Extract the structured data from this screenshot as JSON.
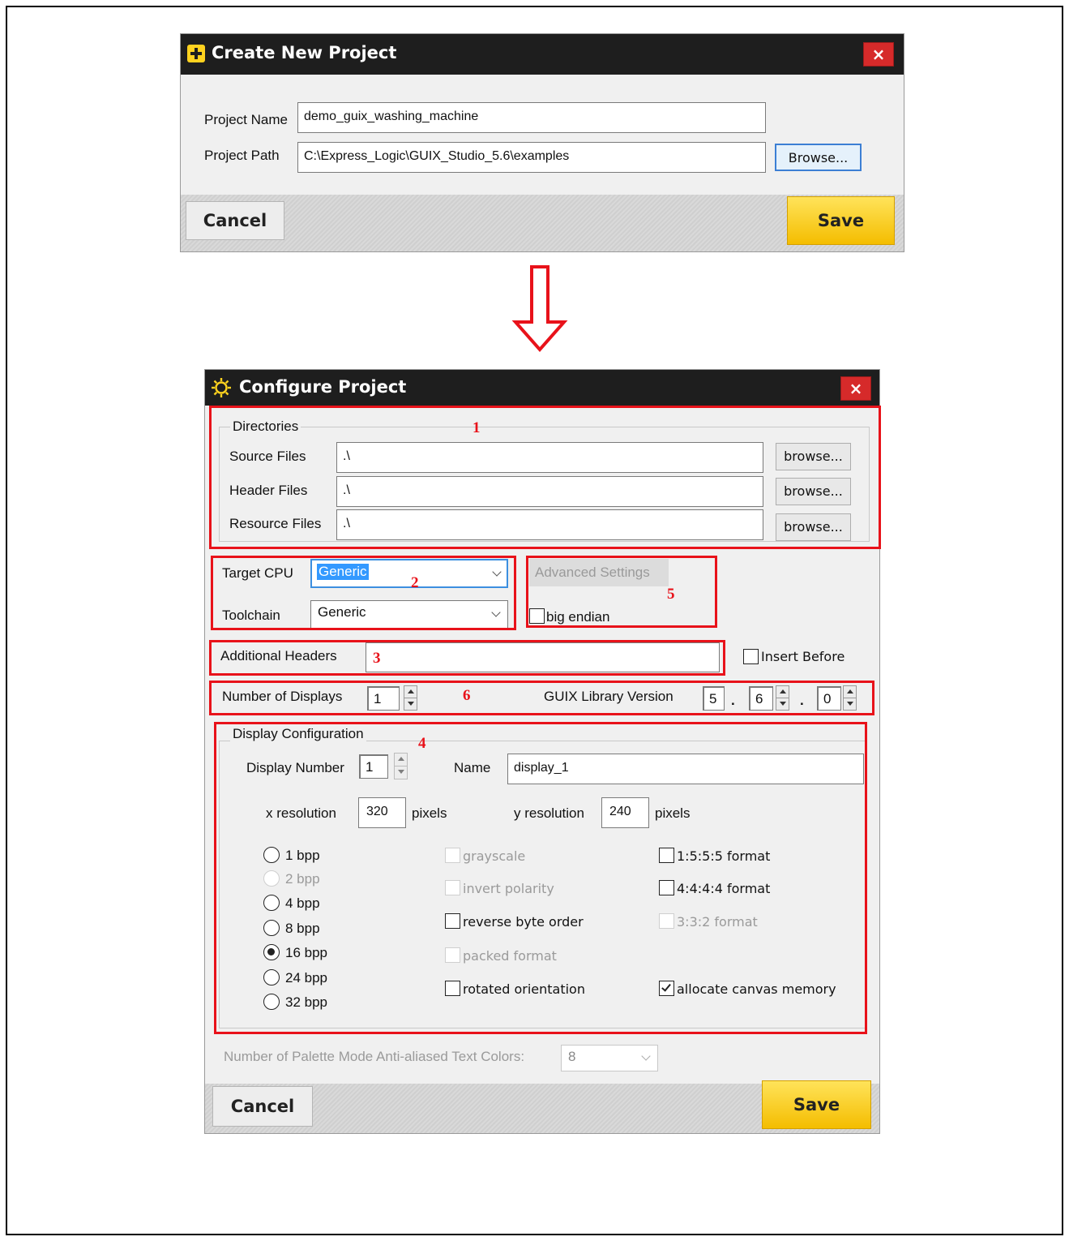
{
  "create_dialog": {
    "title": "Create New Project",
    "close_glyph": "×",
    "project_name_label": "Project Name",
    "project_name_value": "demo_guix_washing_machine",
    "project_path_label": "Project Path",
    "project_path_value": "C:\\Express_Logic\\GUIX_Studio_5.6\\examples",
    "browse_label": "Browse...",
    "cancel_label": "Cancel",
    "save_label": "Save",
    "accent_color": "#ffd21f"
  },
  "arrow": {
    "direction": "down",
    "color": "#e8121a"
  },
  "configure_dialog": {
    "title": "Configure Project",
    "close_glyph": "×",
    "directories": {
      "group_title": "Directories",
      "rows": [
        {
          "label": "Source Files",
          "value": ".\\",
          "button": "browse..."
        },
        {
          "label": "Header Files",
          "value": ".\\",
          "button": "browse..."
        },
        {
          "label": "Resource Files",
          "value": ".\\",
          "button": "browse..."
        }
      ]
    },
    "target_cpu_label": "Target CPU",
    "target_cpu_value": "Generic",
    "toolchain_label": "Toolchain",
    "toolchain_value": "Generic",
    "advanced_settings_label": "Advanced Settings",
    "big_endian_label": "big endian",
    "big_endian_checked": false,
    "additional_headers_label": "Additional Headers",
    "additional_headers_value": "",
    "insert_before_label": "Insert Before",
    "insert_before_checked": false,
    "num_displays_label": "Number of Displays",
    "num_displays_value": "1",
    "guix_version_label": "GUIX Library Version",
    "guix_version_major": "5",
    "guix_version_minor": "6",
    "guix_version_patch": "0",
    "version_sep": ".",
    "display_config": {
      "group_title": "Display Configuration",
      "display_number_label": "Display Number",
      "display_number_value": "1",
      "name_label": "Name",
      "name_value": "display_1",
      "x_res_label": "x resolution",
      "x_res_value": "320",
      "y_res_label": "y resolution",
      "y_res_value": "240",
      "pixels_label": "pixels",
      "bpp_options": [
        {
          "label": "1 bpp",
          "selected": false,
          "enabled": true
        },
        {
          "label": "2 bpp",
          "selected": false,
          "enabled": false
        },
        {
          "label": "4 bpp",
          "selected": false,
          "enabled": true
        },
        {
          "label": "8 bpp",
          "selected": false,
          "enabled": true
        },
        {
          "label": "16 bpp",
          "selected": true,
          "enabled": true
        },
        {
          "label": "24 bpp",
          "selected": false,
          "enabled": true
        },
        {
          "label": "32 bpp",
          "selected": false,
          "enabled": true
        }
      ],
      "options_mid": [
        {
          "label": "grayscale",
          "checked": false,
          "enabled": false
        },
        {
          "label": "invert polarity",
          "checked": false,
          "enabled": false
        },
        {
          "label": "reverse byte order",
          "checked": false,
          "enabled": true
        },
        {
          "label": "packed format",
          "checked": false,
          "enabled": false
        },
        {
          "label": "rotated orientation",
          "checked": false,
          "enabled": true
        }
      ],
      "options_right": [
        {
          "label": "1:5:5:5 format",
          "checked": false,
          "enabled": true
        },
        {
          "label": "4:4:4:4 format",
          "checked": false,
          "enabled": true
        },
        {
          "label": "3:3:2 format",
          "checked": false,
          "enabled": false
        },
        {
          "label": "allocate canvas memory",
          "checked": true,
          "enabled": true
        }
      ]
    },
    "palette_label": "Number of Palette Mode Anti-aliased Text Colors:",
    "palette_value": "8",
    "cancel_label": "Cancel",
    "save_label": "Save",
    "annotations": [
      "1",
      "2",
      "3",
      "4",
      "5",
      "6"
    ],
    "annotation_color": "#e8121a"
  }
}
